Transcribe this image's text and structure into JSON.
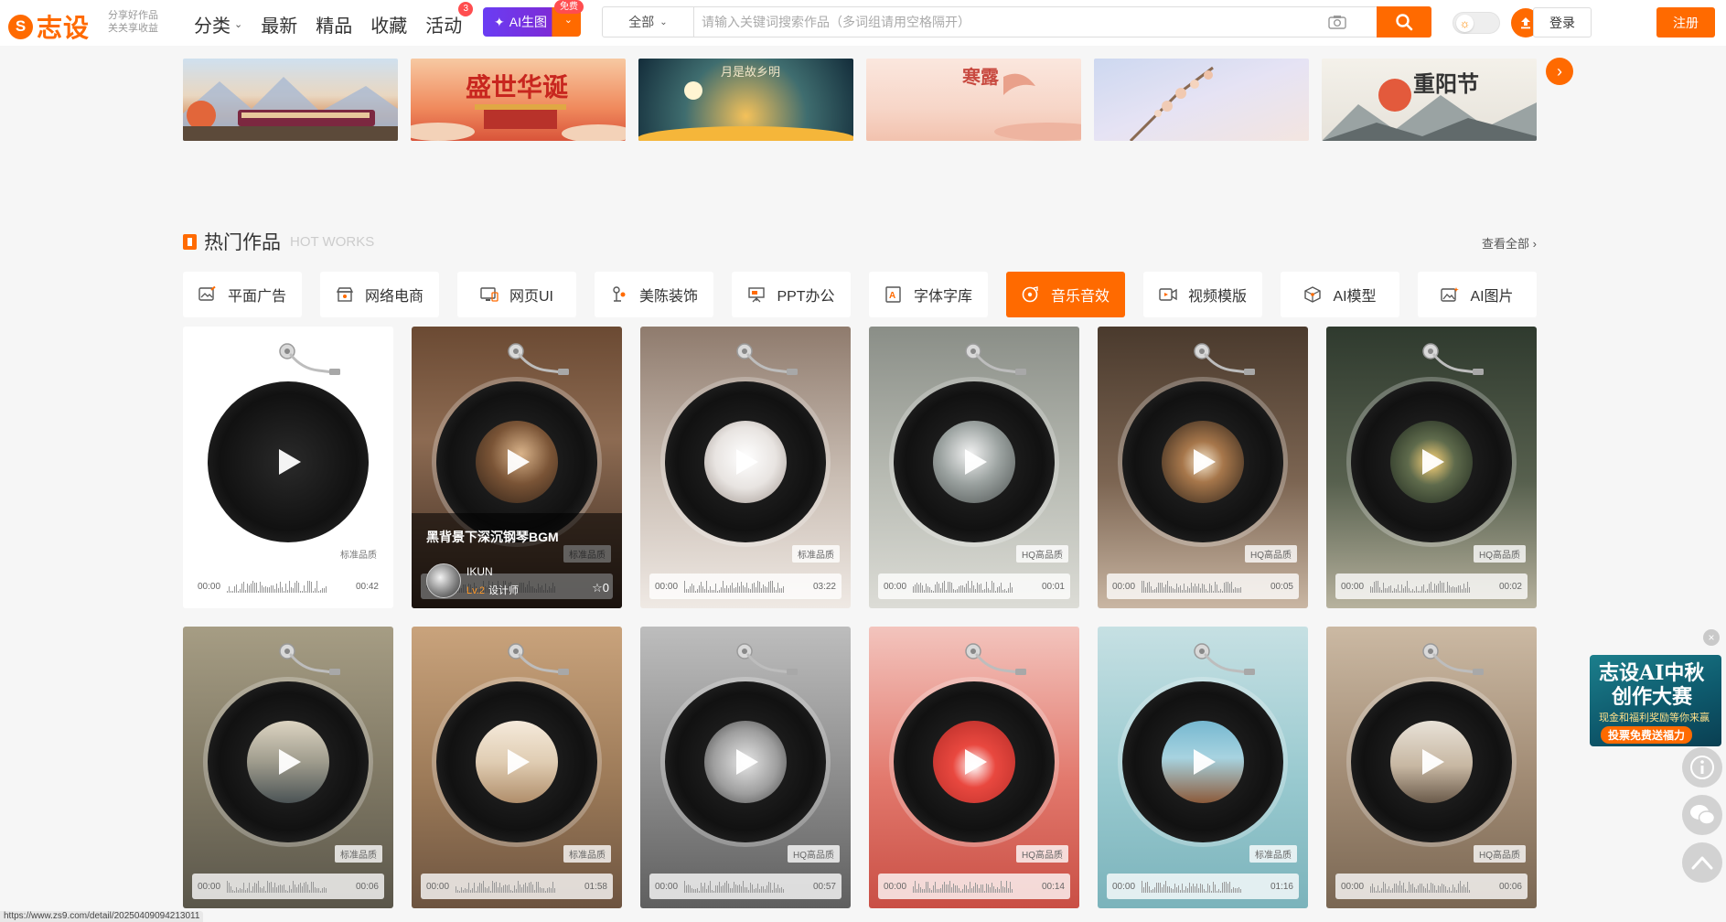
{
  "header": {
    "logo_mark": "S",
    "logo_text": "志设",
    "slogan_line1": "分享好作品",
    "slogan_line2": "关关享收益",
    "nav": [
      {
        "label": "分类",
        "has_dropdown": true
      },
      {
        "label": "最新"
      },
      {
        "label": "精品"
      },
      {
        "label": "收藏"
      },
      {
        "label": "活动",
        "badge": "3"
      }
    ],
    "ai_button": {
      "label": "AI生图",
      "tag": "免费"
    },
    "search": {
      "scope": "全部",
      "placeholder": "请输入关键词搜索作品（多词组请用空格隔开）",
      "value": ""
    },
    "login": "登录",
    "register": "注册"
  },
  "banners": [
    {
      "name": "train-autumn",
      "title": ""
    },
    {
      "name": "national-day",
      "title": "盛世华诞"
    },
    {
      "name": "mid-autumn",
      "title": "月是故乡明"
    },
    {
      "name": "cold-dew",
      "title": "寒露"
    },
    {
      "name": "blossom",
      "title": ""
    },
    {
      "name": "double-ninth",
      "title": "重阳节"
    }
  ],
  "section": {
    "title": "热门作品",
    "subtitle": "HOT WORKS",
    "view_all": "查看全部"
  },
  "tabs": [
    {
      "label": "平面广告",
      "icon": "image-edit-icon",
      "active": false
    },
    {
      "label": "网络电商",
      "icon": "shop-icon",
      "active": false
    },
    {
      "label": "网页UI",
      "icon": "monitor-icon",
      "active": false
    },
    {
      "label": "美陈装饰",
      "icon": "decoration-icon",
      "active": false
    },
    {
      "label": "PPT办公",
      "icon": "presentation-icon",
      "active": true
    },
    {
      "label": "字体字库",
      "icon": "font-icon",
      "active": false
    },
    {
      "label": "音乐音效",
      "icon": "music-disc-icon",
      "active": true
    },
    {
      "label": "视频模版",
      "icon": "video-icon",
      "active": false
    },
    {
      "label": "AI模型",
      "icon": "cube-icon",
      "active": false
    },
    {
      "label": "AI图片",
      "icon": "ai-image-icon",
      "active": false
    }
  ],
  "cards": [
    {
      "start": "00:00",
      "duration": "00:42",
      "quality": "标准品质",
      "bg": "white",
      "art": "none"
    },
    {
      "start": "00:00",
      "duration": "",
      "quality": "标准品质",
      "bg": "brown",
      "art": "piano-man",
      "hover": {
        "title": "黑背景下深沉钢琴BGM",
        "author": "IKUN",
        "level": "Lv.2",
        "role": "设计师",
        "favorites": "0"
      }
    },
    {
      "start": "00:00",
      "duration": "03:22",
      "quality": "标准品质",
      "bg": "taupe",
      "art": "white-dress"
    },
    {
      "start": "00:00",
      "duration": "00:01",
      "quality": "HQ高品质",
      "bg": "gray",
      "art": "crystal-ball"
    },
    {
      "start": "00:00",
      "duration": "00:05",
      "quality": "HQ高品质",
      "bg": "dark-brown",
      "art": "shatter"
    },
    {
      "start": "00:00",
      "duration": "00:02",
      "quality": "HQ高品质",
      "bg": "dark-green",
      "art": "sparks"
    },
    {
      "start": "00:00",
      "duration": "00:06",
      "quality": "标准品质",
      "bg": "olive",
      "art": "ship"
    },
    {
      "start": "00:00",
      "duration": "01:58",
      "quality": "标准品质",
      "bg": "tan",
      "art": "piano-room"
    },
    {
      "start": "00:00",
      "duration": "00:57",
      "quality": "HQ高品质",
      "bg": "silver",
      "art": "sad-girl"
    },
    {
      "start": "00:00",
      "duration": "00:14",
      "quality": "HQ高品质",
      "bg": "red",
      "art": "strawberry"
    },
    {
      "start": "00:00",
      "duration": "01:16",
      "quality": "标准品质",
      "bg": "teal",
      "art": "sea-hair"
    },
    {
      "start": "00:00",
      "duration": "00:06",
      "quality": "HQ高品质",
      "bg": "sand",
      "art": "heels"
    }
  ],
  "float_ad": {
    "title_line1": "志设AI中秋",
    "title_line2": "创作大赛",
    "small": "现金和福利奖励等你来赢",
    "button": "投票免费送福力"
  },
  "status_url": "https://www.zs9.com/detail/20250409094213011"
}
